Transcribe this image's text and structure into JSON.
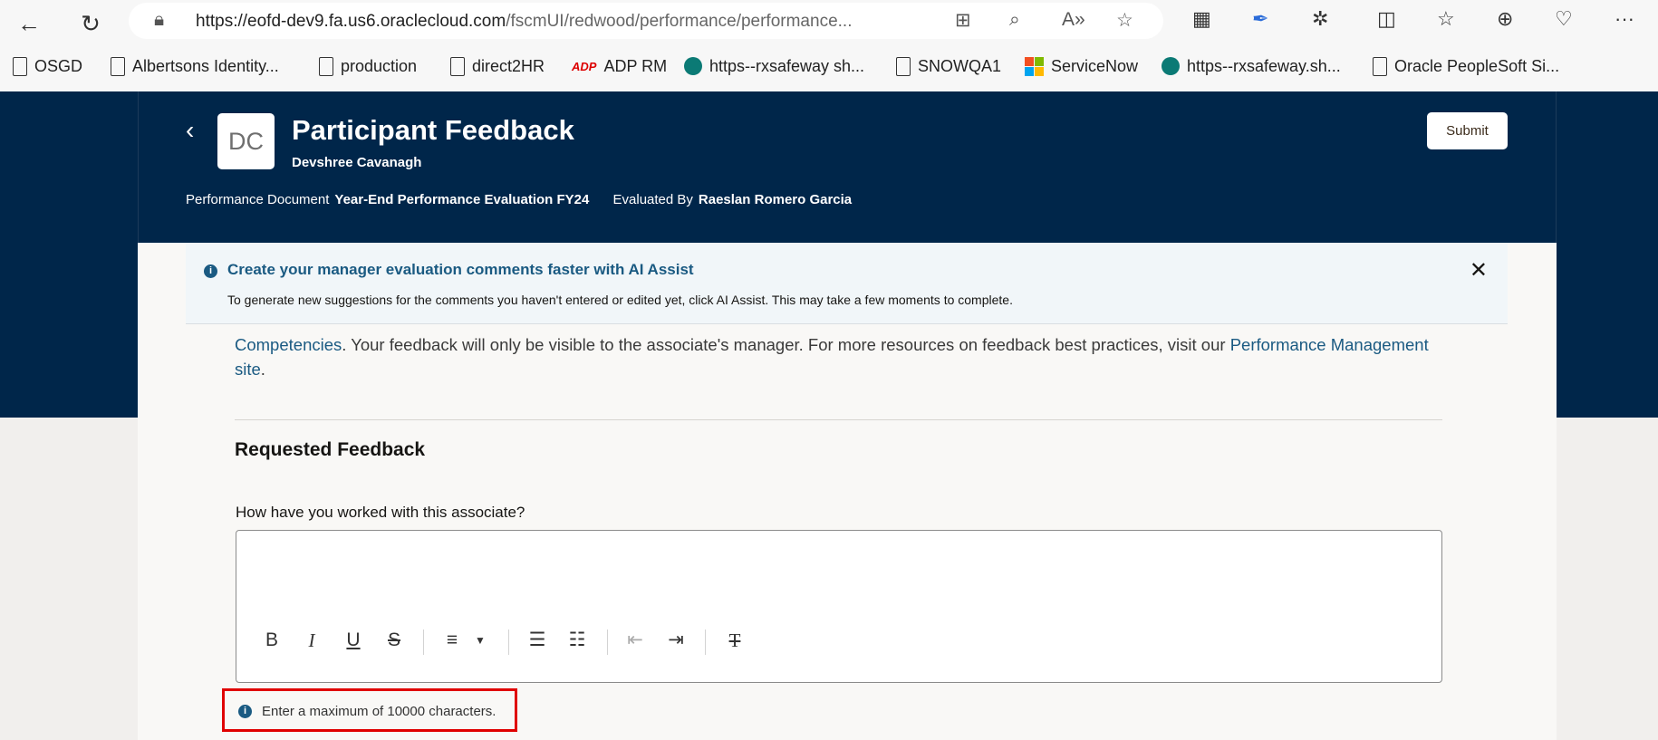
{
  "browser": {
    "url_host": "https://eofd-dev9.fa.us6.oraclecloud.com",
    "url_path": "/fscmUI/redwood/performance/performance...",
    "bookmarks": [
      "OSGD",
      "Albertsons Identity...",
      "production",
      "direct2HR",
      "ADP RM",
      "https--rxsafeway sh...",
      "SNOWQA1",
      "ServiceNow",
      "https--rxsafeway.sh...",
      "Oracle PeopleSoft Si..."
    ]
  },
  "header": {
    "avatar_initials": "DC",
    "title": "Participant Feedback",
    "subtitle": "Devshree Cavanagh",
    "submit_label": "Submit",
    "doc_label": "Performance Document",
    "doc_value": "Year-End Performance Evaluation FY24",
    "evaluated_label": "Evaluated By",
    "evaluated_value": "Raeslan Romero Garcia"
  },
  "banner": {
    "title": "Create your manager evaluation comments faster with AI Assist",
    "text": "To generate new suggestions for the comments you haven't entered or edited yet, click AI Assist. This may take a few moments to complete."
  },
  "intro": {
    "link1": "Competencies",
    "text": ". Your feedback will only be visible to the associate's manager. For more resources on feedback best practices, visit our ",
    "link2": "Performance Management site",
    "end": "."
  },
  "section_title": "Requested Feedback",
  "question": "How have you worked with this associate?",
  "hint": "Enter a maximum of 10000 characters.",
  "colors": {
    "navy": "#00264a",
    "link": "#1a5a82",
    "highlight": "#e00000"
  }
}
